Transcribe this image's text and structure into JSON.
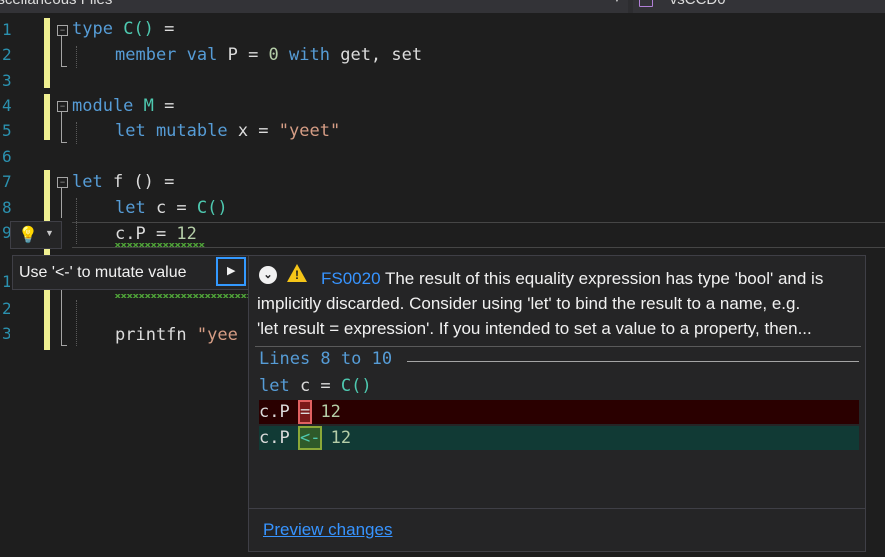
{
  "navbar": {
    "file_dropdown": "iscellaneous Files",
    "member_dropdown": "~vsCCD0"
  },
  "line_numbers": [
    "1",
    "2",
    "3",
    "4",
    "5",
    "6",
    "7",
    "8",
    "9",
    "1",
    "2",
    "3"
  ],
  "code": {
    "l1": {
      "kw": "type",
      "name": "C()",
      "eq": " ="
    },
    "l2": {
      "kw1": "member val",
      "id": " P = ",
      "num": "0",
      "kw2": " with",
      "rest": " get, set"
    },
    "l4": {
      "kw": "module",
      "name": " M",
      "eq": " ="
    },
    "l5": {
      "kw": "let mutable",
      "id": " x = ",
      "str": "\"yeet\""
    },
    "l7": {
      "kw": "let",
      "id": " f () ="
    },
    "l8": {
      "kw": "let",
      "id": " c = ",
      "ty": "C()"
    },
    "l9": {
      "id": "c.P = ",
      "num": "12"
    },
    "l12": {
      "id": "printfn ",
      "str": "\"yee"
    }
  },
  "quick_actions": {
    "items": [
      {
        "label": "Use '<-' to mutate value"
      }
    ]
  },
  "preview": {
    "code": "FS0020",
    "message_line1": "The result of this equality expression has type 'bool' and is",
    "message_line2": "implicitly discarded. Consider using 'let' to bind the result to a name, e.g.",
    "message_line3": "'let result = expression'. If you intended to set a value to a property, then...",
    "diff_header": "Lines 8 to 10",
    "diff": {
      "context": {
        "kw": "let",
        "id": " c = ",
        "ty": "C()"
      },
      "removed": {
        "pre": "c.P ",
        "op": "=",
        "post": " 12"
      },
      "added": {
        "pre": "c.P ",
        "op": "<-",
        "post": " 12"
      }
    },
    "preview_changes_label": "Preview changes"
  },
  "colors": {
    "background": "#1e1e1e",
    "keyword": "#569cd6",
    "type": "#4ec9b0",
    "string": "#d69d85",
    "number": "#b5cea8",
    "line_number": "#2b91af",
    "link": "#3794ff",
    "warning": "#f5c518",
    "diff_removed_bg": "#2a0000",
    "diff_added_bg": "#113a35"
  }
}
